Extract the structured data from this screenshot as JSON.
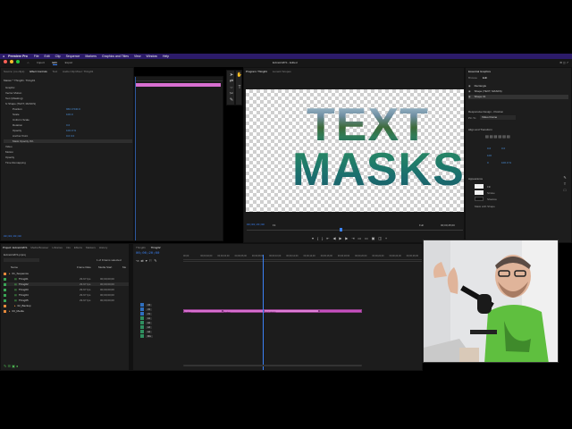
{
  "menubar": {
    "app_name": "Premiere Pro",
    "items": [
      "File",
      "Edit",
      "Clip",
      "Sequence",
      "Markers",
      "Graphics and Titles",
      "View",
      "Window",
      "Help"
    ]
  },
  "workspace": {
    "tabs": [
      "Import",
      "Edit",
      "Export"
    ],
    "active_tab": "Edit",
    "project_title": "ExtraArt2FS - Edited"
  },
  "effect_controls": {
    "tabs": [
      "Source: (no clips)",
      "Effect Controls",
      "Text",
      "Audio Clip Mixer: Thing01"
    ],
    "header": "Master * Thing01.  Thing01",
    "rows": [
      {
        "label": "Graphic",
        "value": ""
      },
      {
        "label": "Vector Motion",
        "value": ""
      },
      {
        "label": "Text (Masking)",
        "value": ""
      },
      {
        "label": "fx  Shape (TEXT, MASKS)",
        "value": ""
      },
      {
        "label": "Position",
        "value": "960.0   540.0"
      },
      {
        "label": "Scale",
        "value": "100.0"
      },
      {
        "label": "Uniform Scale",
        "value": ""
      },
      {
        "label": "Rotation",
        "value": "0.0"
      },
      {
        "label": "Opacity",
        "value": "100.0 %"
      },
      {
        "label": "Anchor Point",
        "value": "0.0   0.0"
      },
      {
        "label": "Mask Opacity 0%",
        "value": ""
      },
      {
        "label": "Video",
        "value": ""
      },
      {
        "label": "Motion",
        "value": ""
      },
      {
        "label": "Opacity",
        "value": ""
      },
      {
        "label": "Time Remapping",
        "value": ""
      }
    ],
    "timecode": "00;00;00;00"
  },
  "program": {
    "tabs": [
      "Program: Thing01",
      "Lumetri Scopes"
    ],
    "line1": "TEXT",
    "line2": "MASKS",
    "timecode_left": "00;00;20;00",
    "fit": "Fit",
    "resolution": "Full",
    "timecode_right": "00;00;45;00"
  },
  "essential_graphics": {
    "title": "Essential Graphics",
    "tabs": [
      "Browse",
      "Edit"
    ],
    "layers": [
      "Rectangle",
      "Shape (TEXT, MASKS)",
      "Shape 01"
    ],
    "section_responsive": "Responsive Design - Position",
    "pin_label": "Pin To:",
    "pin_value": "Video Frame",
    "section_align": "Align and Transform",
    "section_appearance": "Appearance",
    "fill_label": "Fill",
    "stroke_label": "Stroke",
    "shadow_label": "Shadow",
    "mask_label": "Mask with Shape",
    "x_val": "0.0",
    "y_val": "0.0",
    "scale_val": "100",
    "rotation_val": "0",
    "opacity_val": "100.0 %"
  },
  "project": {
    "tabs": [
      "Project: ExtraArt2FS",
      "Media Browser",
      "Libraries",
      "Info",
      "Effects",
      "Markers",
      "History"
    ],
    "file": "ExtraArt2FS.prproj",
    "selected_count": "1 of 9 items selected",
    "columns": [
      "Name",
      "Frame Rate",
      "Media Start",
      "Me"
    ],
    "items": [
      {
        "name": "01_Sequence",
        "rate": "",
        "start": "",
        "color": "#e5893b",
        "indent": 0
      },
      {
        "name": "Thing01",
        "rate": "29.97 fps",
        "start": "00;00;00;00",
        "color": "#3aa655",
        "indent": 1
      },
      {
        "name": "Thing02",
        "rate": "29.97 fps",
        "start": "00;00;00;00",
        "color": "#3aa655",
        "indent": 1
      },
      {
        "name": "Thing03",
        "rate": "29.97 fps",
        "start": "00;00;00;00",
        "color": "#3aa655",
        "indent": 1
      },
      {
        "name": "Thing04",
        "rate": "29.97 fps",
        "start": "00;00;00;00",
        "color": "#3aa655",
        "indent": 1
      },
      {
        "name": "Thing05",
        "rate": "29.97 fps",
        "start": "00;00;00;00",
        "color": "#3aa655",
        "indent": 1
      },
      {
        "name": "02_Backup",
        "rate": "",
        "start": "",
        "color": "#e5893b",
        "indent": 1
      },
      {
        "name": "03_Media",
        "rate": "",
        "start": "",
        "color": "#e5893b",
        "indent": 0
      }
    ]
  },
  "timeline": {
    "tabs": [
      "Thing01",
      "Thing02"
    ],
    "timecode": "00;00;20;00",
    "ruler": [
      "00;00",
      "00;00;02;00",
      "00;00;04;00",
      "00;00;06;00",
      "00;00;08;00",
      "00;00;10;00",
      "00;00;12;00",
      "00;00;14;00",
      "00;00;16;00",
      "00;00;18;00",
      "00;00;20;00",
      "00;00;22;00",
      "00;00;24;00",
      "00;00;26;00"
    ],
    "tracks": [
      "V3",
      "V2",
      "V1",
      "A1",
      "A2",
      "A3",
      "A4",
      "Mix"
    ],
    "clips": [
      "Gradient",
      "Gradient",
      "TEXT MASKS"
    ]
  },
  "colors": {
    "accent_blue": "#3b82f6",
    "clip_pink": "#d86fd0",
    "clip_magenta": "#c74fc0",
    "menu_purple": "#2c1b69"
  }
}
